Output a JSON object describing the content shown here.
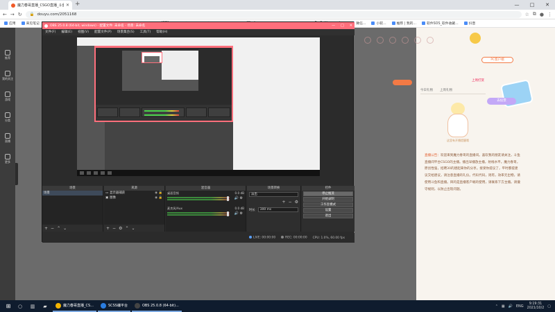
{
  "browser": {
    "tab_title": "魔力春哥直播_CSGO直播_斗鱼...",
    "new_tab": "+",
    "url": "douyu.com/2051168",
    "minimize": "—",
    "maximize": "□",
    "close": "✕",
    "bookmarks": [
      "应用",
      "来见笔记",
      "全讯的家",
      "百度一下",
      "中国",
      "快速访问",
      "美剧大全",
      "WIN...",
      "黑框",
      "美丽时代",
      "广告中国",
      "Windo",
      "黑柚资源",
      "还原组...",
      "ProSettings.net -...",
      "微信...",
      "小软...",
      "推荐 | 我的...",
      "软件SOS_软件收藏...",
      "抖音"
    ]
  },
  "douyu": {
    "pc_button": "PC客户端",
    "side_tabs": [
      "今日礼物",
      "上周礼物"
    ],
    "fan_text": "上周打赏",
    "sticker_text": "去投票",
    "mascot_caption": "这里有开播提醒哦",
    "notice_label": "直播公告：",
    "notice_text": "欢迎来到魔力春哥的直播间。喜欢我的朋友请关注，斗鱼直播间平台CSGO的主播。播出早播放主播，射线水平。魔力春哥，原创性强，招聘30的建起来你的分享。接受你提议了，平时都提建议交给建议，请注意直播的礼仪。代码代码，则有，效率元出物，请使用斗鱼和直播。目的是直播客户端的使用，请联系下方主播。请遵守规则，以防止出现问题。",
    "left_nav": [
      "推荐",
      "我的关注",
      "游戏",
      "分类",
      "直播",
      "更多"
    ]
  },
  "obs": {
    "title": "OBS 25.0.8 (64-bit, windows) - 配置文件: 未命名 - 场景: 未命名",
    "menu": [
      "文件(F)",
      "编辑(E)",
      "视图(V)",
      "配置文件(P)",
      "场景集合(S)",
      "工具(T)",
      "帮助(H)"
    ],
    "docks": {
      "scenes": {
        "title": "场景",
        "items": [
          "场景"
        ]
      },
      "sources": {
        "title": "来源",
        "items": [
          "显示器捕获",
          "图像"
        ]
      },
      "mixer": {
        "title": "混音器",
        "channels": [
          {
            "name": "桌面音频",
            "db": "0.0 dB"
          },
          {
            "name": "麦克风/Aux",
            "db": "0.0 dB"
          }
        ]
      },
      "transitions": {
        "title": "场景转换",
        "type": "淡出",
        "duration_label": "时长",
        "duration": "300 ms"
      },
      "controls": {
        "title": "控件",
        "buttons": [
          "停止推流",
          "开始录制",
          "工作室模式",
          "设置",
          "退出"
        ]
      }
    },
    "status": {
      "live": "LIVE: 00:00:00",
      "rec": "REC: 00:00:00",
      "cpu": "CPU: 1.0%, 60.00 fps"
    }
  },
  "taskbar": {
    "start": "⊞",
    "apps": [
      {
        "label": "魔力春哥直播_CS...",
        "color": "#f4b400"
      },
      {
        "label": "SCSS编平台",
        "color": "#2a7de1"
      },
      {
        "label": "OBS 25.0.8 (64-bit)...",
        "color": "#444444"
      }
    ],
    "lang": "ENG",
    "time": "9:19:31",
    "date": "2021/10/2"
  }
}
